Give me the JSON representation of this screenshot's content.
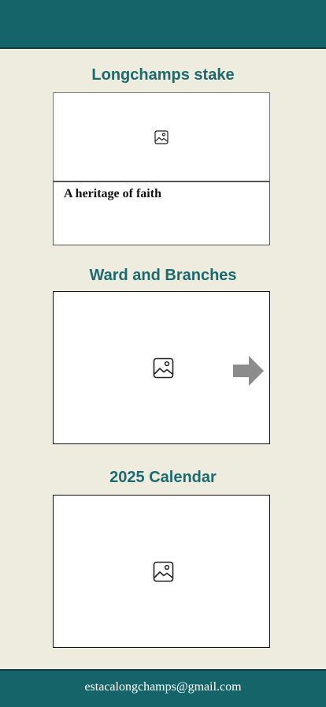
{
  "sections": [
    {
      "title": "Longchamps stake",
      "image_icon": "image-placeholder-icon",
      "caption": "A heritage of faith"
    },
    {
      "title": "Ward and Branches",
      "image_icon": "image-placeholder-icon",
      "nav_icon": "arrow-right-icon"
    },
    {
      "title": "2025 Calendar",
      "image_icon": "image-placeholder-icon"
    }
  ],
  "footer": {
    "email": "estacalongchamps@gmail.com"
  },
  "colors": {
    "header_bg": "#15646a",
    "page_bg": "#eeebdf",
    "title_text": "#1b6a6f",
    "arrow": "#8c8c8c"
  }
}
